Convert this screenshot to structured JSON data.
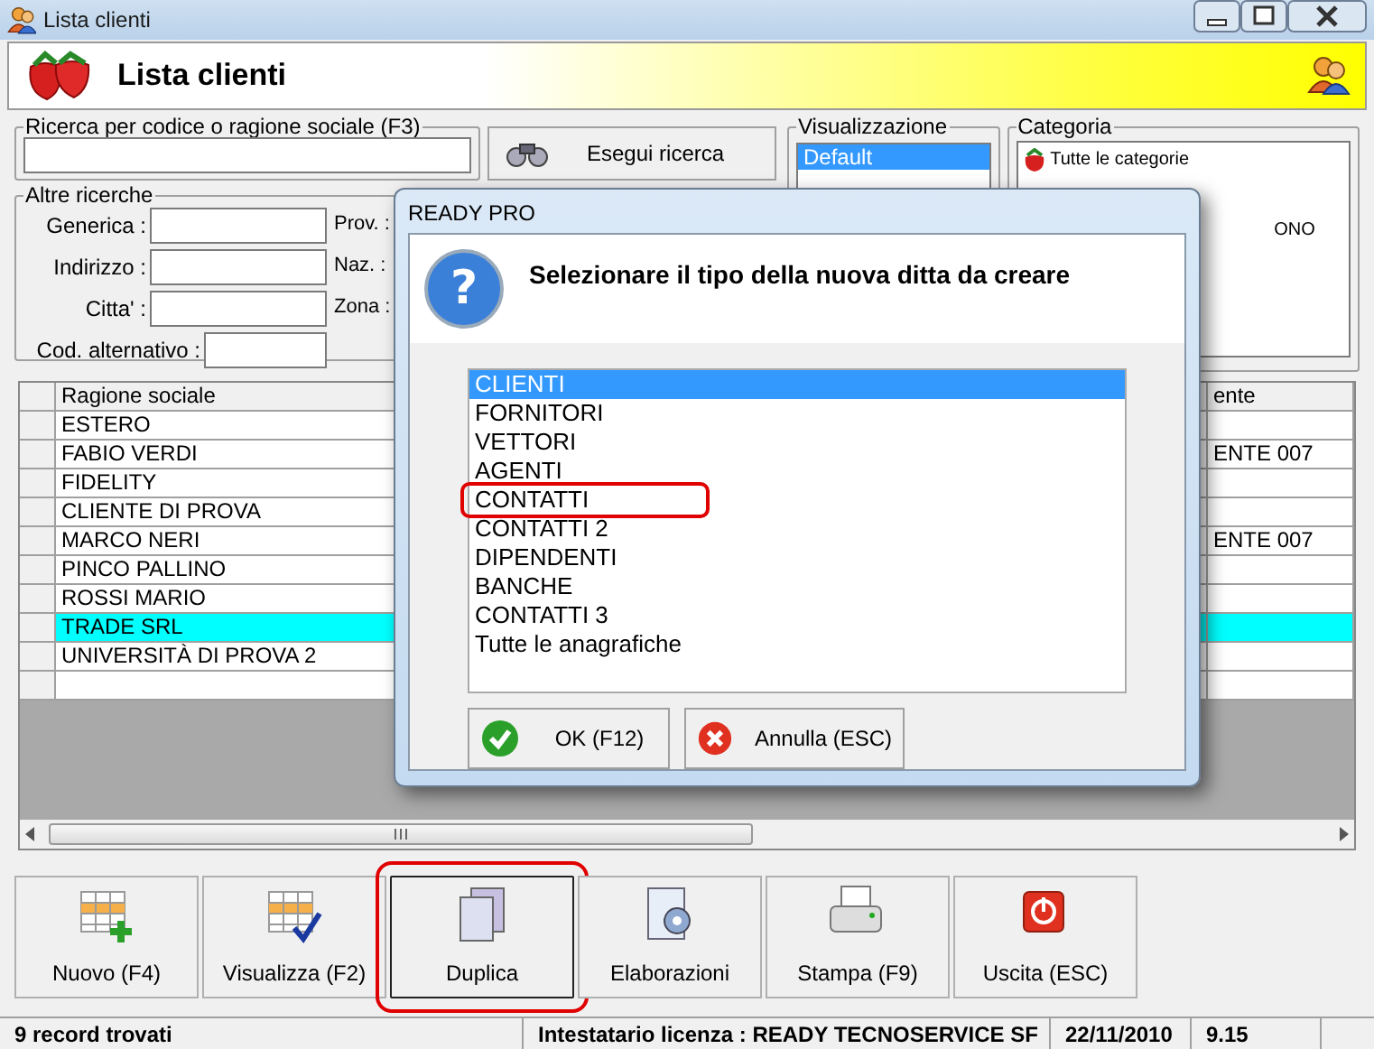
{
  "window": {
    "title": "Lista clienti"
  },
  "header": {
    "title": "Lista clienti"
  },
  "search": {
    "legend": "Ricerca per codice o ragione sociale (F3)",
    "button": "Esegui ricerca"
  },
  "other_searches": {
    "legend": "Altre ricerche",
    "fields": [
      {
        "label": "Generica :",
        "wide": false
      },
      {
        "label": "Indirizzo :",
        "wide": false
      },
      {
        "label": "Citta' :",
        "wide": false
      },
      {
        "label": "Cod. alternativo :",
        "wide": true
      }
    ],
    "side_labels": [
      "Prov. :",
      "Naz. :",
      "Zona :"
    ]
  },
  "view": {
    "legend": "Visualizzazione",
    "items": [
      {
        "label": "Default",
        "selected": true
      }
    ]
  },
  "category": {
    "legend": "Categoria",
    "items": [
      "Tutte le categorie",
      "ONO"
    ]
  },
  "table": {
    "columns": [
      "Ragione sociale",
      "ente"
    ],
    "rows": [
      {
        "ragione_sociale": "ESTERO",
        "selected": false
      },
      {
        "ragione_sociale": "FABIO VERDI",
        "column_2": "ENTE 007",
        "selected": false
      },
      {
        "ragione_sociale": "FIDELITY",
        "selected": false
      },
      {
        "ragione_sociale": "CLIENTE DI PROVA",
        "selected": false
      },
      {
        "ragione_sociale": "MARCO NERI",
        "column_2": "ENTE 007",
        "selected": false
      },
      {
        "ragione_sociale": "PINCO PALLINO",
        "selected": false
      },
      {
        "ragione_sociale": "ROSSI MARIO",
        "selected": false
      },
      {
        "ragione_sociale": "TRADE SRL",
        "selected": true
      },
      {
        "ragione_sociale": "UNIVERSITÀ DI PROVA 2",
        "selected": false
      }
    ]
  },
  "toolbar": [
    {
      "label": "Nuovo (F4)",
      "kind": "new",
      "highlighted": false
    },
    {
      "label": "Visualizza (F2)",
      "kind": "view",
      "highlighted": false
    },
    {
      "label": "Duplica",
      "kind": "duplicate",
      "highlighted": true
    },
    {
      "label": "Elaborazioni",
      "kind": "process",
      "highlighted": false
    },
    {
      "label": "Stampa (F9)",
      "kind": "print",
      "highlighted": false
    },
    {
      "label": "Uscita (ESC)",
      "kind": "exit",
      "highlighted": false
    }
  ],
  "status_bar": [
    "9 record trovati",
    "Intestatario licenza : READY TECNOSERVICE SF",
    "22/11/2010",
    "9.15"
  ],
  "dialog": {
    "title": "READY PRO",
    "icon": "?",
    "message": "Selezionare il tipo della nuova ditta da creare",
    "options": [
      {
        "label": "CLIENTI",
        "selected": true,
        "highlighted": false
      },
      {
        "label": "FORNITORI",
        "selected": false,
        "highlighted": false
      },
      {
        "label": "VETTORI",
        "selected": false,
        "highlighted": false
      },
      {
        "label": "AGENTI",
        "selected": false,
        "highlighted": false
      },
      {
        "label": "CONTATTI",
        "selected": false,
        "highlighted": true
      },
      {
        "label": "CONTATTI 2",
        "selected": false,
        "highlighted": false
      },
      {
        "label": "DIPENDENTI",
        "selected": false,
        "highlighted": false
      },
      {
        "label": "BANCHE",
        "selected": false,
        "highlighted": false
      },
      {
        "label": "CONTATTI 3",
        "selected": false,
        "highlighted": false
      },
      {
        "label": "Tutte le anagrafiche",
        "selected": false,
        "highlighted": false
      }
    ],
    "buttons": [
      {
        "label": "OK (F12)",
        "kind": "ok"
      },
      {
        "label": "Annulla (ESC)",
        "kind": "cancel"
      }
    ]
  }
}
